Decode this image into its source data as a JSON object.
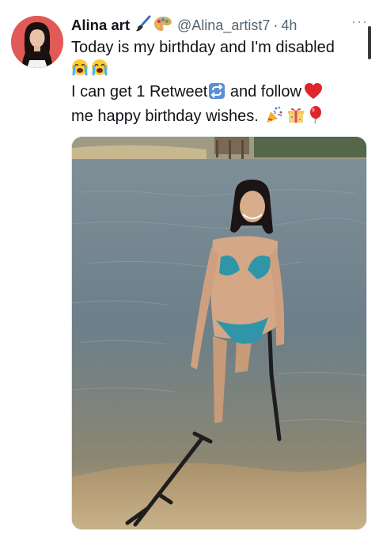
{
  "tweet": {
    "display_name": "Alina art",
    "name_icons": [
      "paintbrush-icon",
      "palette-icon"
    ],
    "handle": "@Alina_artist7",
    "separator": "·",
    "time": "4h",
    "more_label": "···",
    "text_lines": [
      "Today is my birthday and I'm disabled",
      "I can get 1 Retweet",
      " and follow",
      "me happy birthday wishes."
    ],
    "emojis": [
      "loudly-crying-face-icon",
      "loudly-crying-face-icon",
      "repeat-button-icon",
      "red-heart-icon",
      "party-popper-icon",
      "wrapped-gift-icon",
      "balloon-icon"
    ]
  },
  "colors": {
    "text": "#0f1419",
    "secondary": "#536471",
    "avatar_bg": "#e25a55"
  },
  "media": {
    "alt": "photo"
  }
}
